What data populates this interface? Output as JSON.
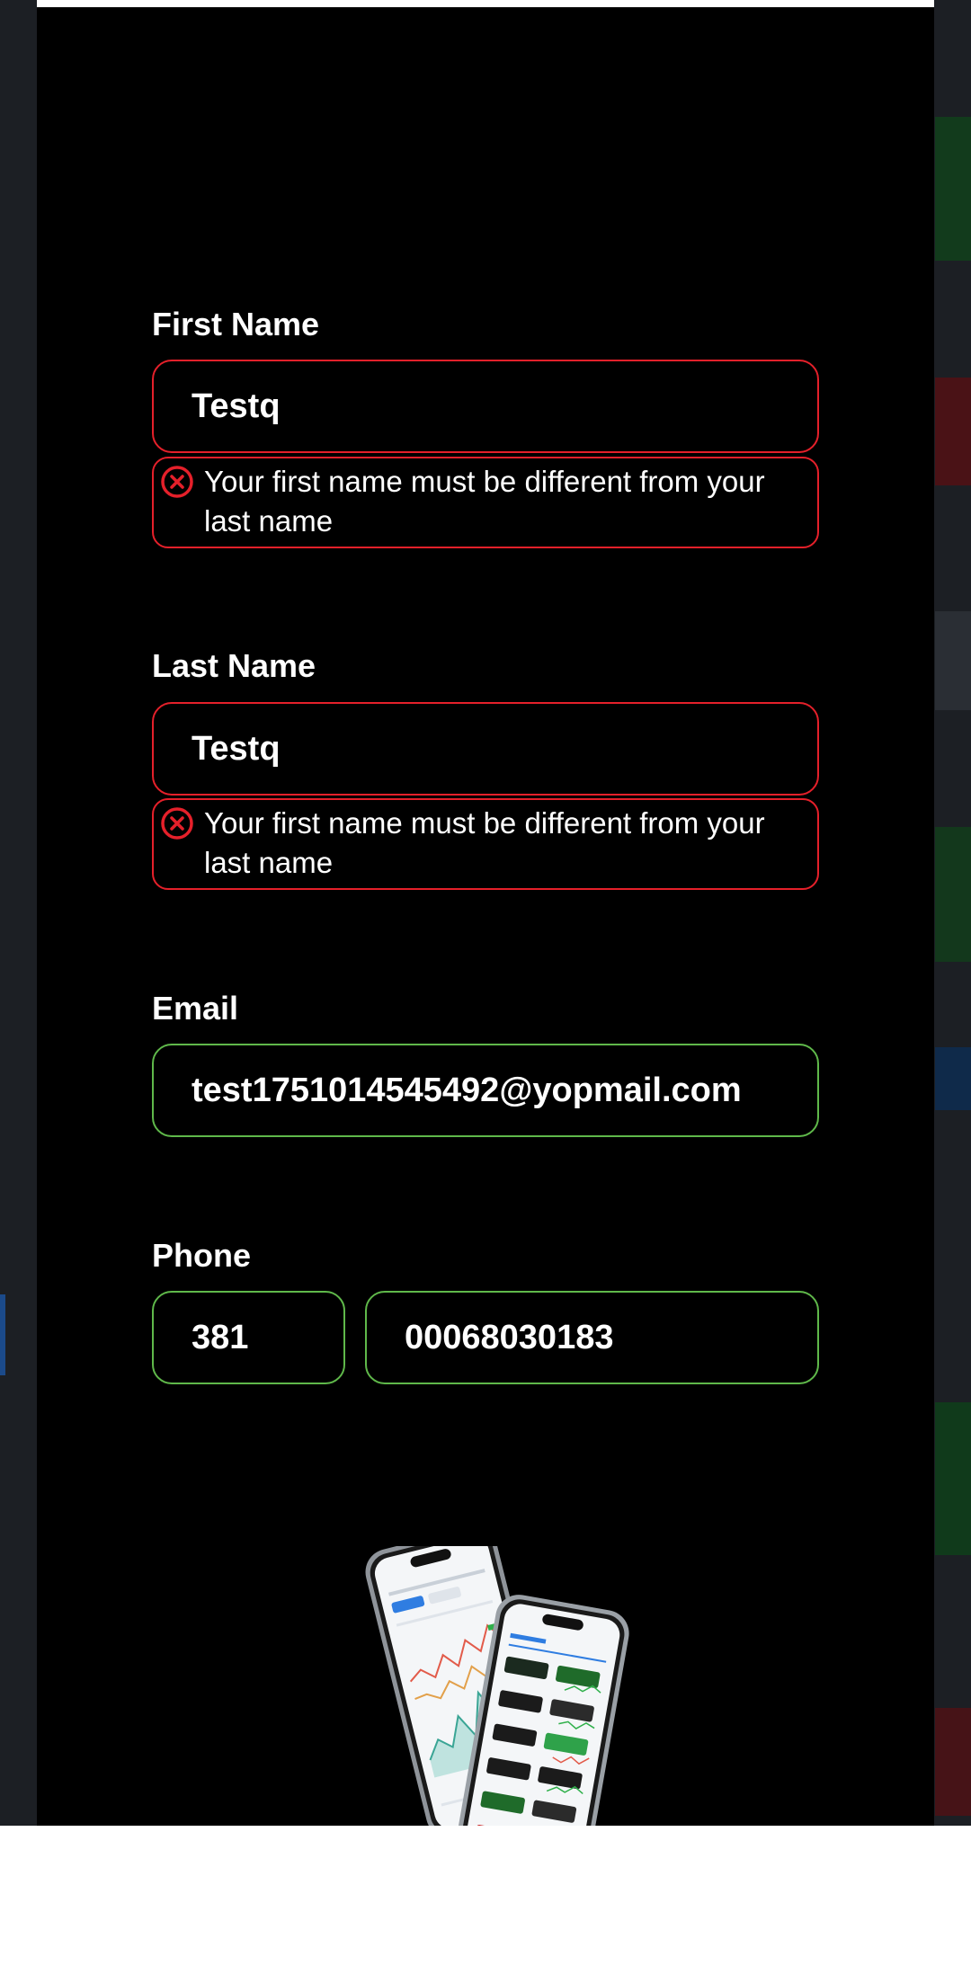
{
  "form": {
    "first_name": {
      "label": "First Name",
      "value": "Testq",
      "error": "Your first name must be different from your last name",
      "status": "invalid"
    },
    "last_name": {
      "label": "Last Name",
      "value": "Testq",
      "error": "Your first name must be different from your last name",
      "status": "invalid"
    },
    "email": {
      "label": "Email",
      "value": "test1751014545492@yopmail.com",
      "status": "valid"
    },
    "phone": {
      "label": "Phone",
      "country_code": "381",
      "number": "00068030183",
      "status": "valid"
    }
  },
  "colors": {
    "error": "#e5202a",
    "valid": "#5fb84a",
    "background": "#000000",
    "text": "#ffffff"
  },
  "icons": {
    "error": "circle-x-icon"
  }
}
